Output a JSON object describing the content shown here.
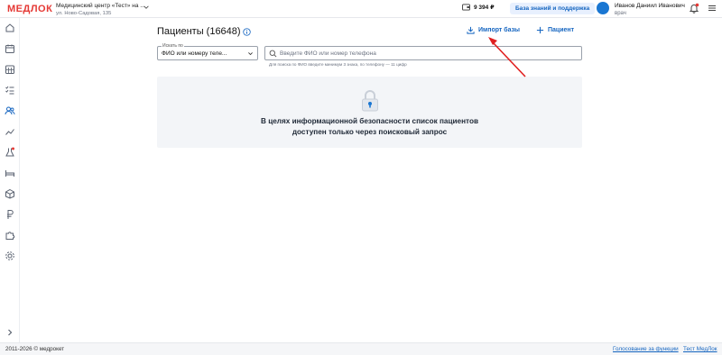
{
  "header": {
    "logo": "МЕДЛОК",
    "clinic_name": "Медицинский центр «Тест» на ...",
    "clinic_address": "ул. Ново-Садовая, 135",
    "balance": "9 394 ₽",
    "knowledge_base": "База знаний и поддержка",
    "user_name": "Иванов Даниил Иванович",
    "user_role": "врач",
    "icons": {
      "balance": "wallet-icon",
      "bell": "bell-icon",
      "menu": "hamburger-menu-icon",
      "chevron": "chevron-down-icon"
    }
  },
  "sidebar": {
    "items": [
      {
        "icon": "home-icon"
      },
      {
        "icon": "calendar-icon"
      },
      {
        "icon": "calendar-grid-icon"
      },
      {
        "icon": "checklist-icon"
      },
      {
        "icon": "patients-icon"
      },
      {
        "icon": "analytics-icon"
      },
      {
        "icon": "flask-icon"
      },
      {
        "icon": "bed-icon"
      },
      {
        "icon": "box-icon"
      },
      {
        "icon": "ruble-icon"
      },
      {
        "icon": "puzzle-icon"
      },
      {
        "icon": "settings-icon"
      }
    ],
    "expand_icon": "chevron-right-icon"
  },
  "main": {
    "title": "Пациенты (16648)",
    "import_label": "Импорт базы",
    "add_patient_label": "Пациент",
    "search_by_label": "Искать по",
    "search_by_value": "ФИО или номеру теле...",
    "search_placeholder": "Введите ФИО или номер телефона",
    "search_hint": "Для поиска по ФИО введите минимум 3 знака, по телефону — 11 цифр",
    "notice_line1": "В целях информационной безопасности список пациентов",
    "notice_line2": "доступен только через поисковый запрос"
  },
  "footer": {
    "copyright": "2011-2026 © медрокет",
    "link_vote": "Голосование за функции",
    "link_test": "Тест МедЛок"
  },
  "colors": {
    "accent": "#1565c0",
    "logo": "#e53935",
    "panel_bg": "#f3f5f8",
    "annotation_arrow": "#e02020"
  }
}
